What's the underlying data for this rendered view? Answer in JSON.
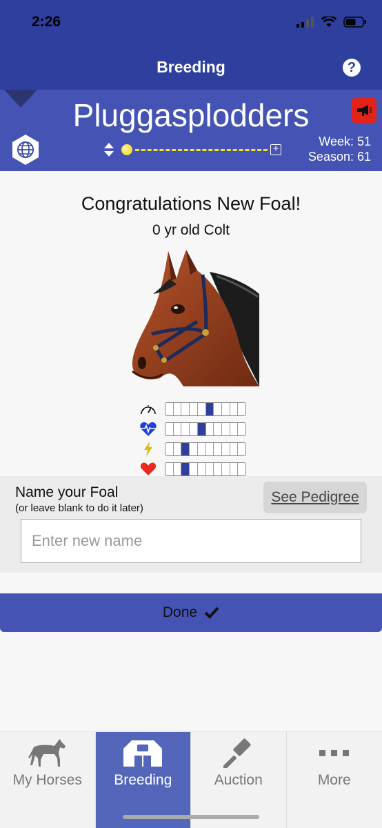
{
  "status": {
    "time": "2:26"
  },
  "nav": {
    "title": "Breeding",
    "help_icon": "question-icon"
  },
  "stable": {
    "name": "Pluggasplodders",
    "week": "Week: 51",
    "season": "Season: 61"
  },
  "foal": {
    "heading": "Congratulations New Foal!",
    "description": "0 yr old Colt",
    "stats": [
      {
        "icon": "speedometer-icon",
        "level": 6,
        "max": 10
      },
      {
        "icon": "heartbeat-icon",
        "level": 5,
        "max": 10
      },
      {
        "icon": "lightning-icon",
        "level": 3,
        "max": 10
      },
      {
        "icon": "heart-icon",
        "level": 3,
        "max": 10
      }
    ]
  },
  "naming": {
    "title": "Name your Foal",
    "subtitle": "(or leave blank to do it later)",
    "pedigree_label": "See Pedigree",
    "input_placeholder": "Enter new name",
    "input_value": ""
  },
  "done_label": "Done",
  "tabs": [
    {
      "label": "My Horses",
      "icon": "horse-icon",
      "active": false
    },
    {
      "label": "Breeding",
      "icon": "barn-icon",
      "active": true
    },
    {
      "label": "Auction",
      "icon": "gavel-icon",
      "active": false
    },
    {
      "label": "More",
      "icon": "ellipsis-icon",
      "active": false
    }
  ],
  "colors": {
    "nav": "#2e3f9e",
    "header": "#4554b4",
    "active_tab": "#5466ba",
    "alert": "#e2231a"
  }
}
